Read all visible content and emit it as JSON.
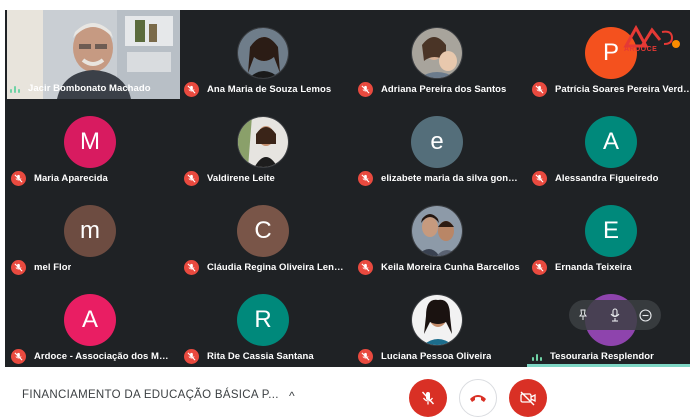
{
  "participants": [
    {
      "name": "Jacir Bombonato Machado",
      "type": "video",
      "mic": "speaking"
    },
    {
      "name": "Ana Maria de Souza Lemos",
      "type": "photo",
      "mic": "muted"
    },
    {
      "name": "Adriana Pereira dos Santos",
      "type": "photo",
      "mic": "muted"
    },
    {
      "name": "Patrícia Soares Pereira Verdeiro",
      "type": "initial",
      "initial": "P",
      "color": "#f4511e",
      "mic": "muted"
    },
    {
      "name": "Maria Aparecida",
      "type": "initial",
      "initial": "M",
      "color": "#d81b60",
      "mic": "muted"
    },
    {
      "name": "Valdirene Leite",
      "type": "photo",
      "mic": "muted"
    },
    {
      "name": "elizabete maria da silva gonça...",
      "type": "initial",
      "initial": "e",
      "color": "#546e7a",
      "mic": "muted"
    },
    {
      "name": "Alessandra Figueiredo",
      "type": "initial",
      "initial": "A",
      "color": "#00897b",
      "mic": "muted"
    },
    {
      "name": "mel Flor",
      "type": "initial",
      "initial": "m",
      "color": "#6d4c41",
      "mic": "muted"
    },
    {
      "name": "Cláudia Regina Oliveira Lenk A...",
      "type": "initial",
      "initial": "C",
      "color": "#795548",
      "mic": "muted"
    },
    {
      "name": "Keila Moreira Cunha Barcellos",
      "type": "photo",
      "mic": "muted"
    },
    {
      "name": "Ernanda Teixeira",
      "type": "initial",
      "initial": "E",
      "color": "#00897b",
      "mic": "muted"
    },
    {
      "name": "Ardoce - Associação dos Muni...",
      "type": "initial",
      "initial": "A",
      "color": "#e91e63",
      "mic": "muted"
    },
    {
      "name": "Rita De Cassia Santana",
      "type": "initial",
      "initial": "R",
      "color": "#00897b",
      "mic": "muted"
    },
    {
      "name": "Luciana Pessoa Oliveira",
      "type": "photo",
      "mic": "muted"
    },
    {
      "name": "Tesouraria Resplendor",
      "type": "initial",
      "initial": "",
      "color": "#8e44ad",
      "mic": "speaking"
    }
  ],
  "logo": {
    "text": "ARDOCE"
  },
  "meeting": {
    "title": "FINANCIAMENTO DA EDUCAÇÃO BÁSICA P...",
    "chevron": "^"
  },
  "controls": {
    "mic": {
      "icon": "mic-off-icon",
      "color": "#d93025"
    },
    "hangup": {
      "icon": "hangup-icon",
      "color": "#d93025"
    },
    "camera": {
      "icon": "camera-off-icon",
      "color": "#d93025"
    }
  },
  "hover_controls": [
    "pin-icon",
    "mic-icon",
    "remove-icon"
  ],
  "colors": {
    "grid_bg": "#1f2225",
    "muted": "#e94a3f",
    "speaking": "#6fd3a6"
  }
}
